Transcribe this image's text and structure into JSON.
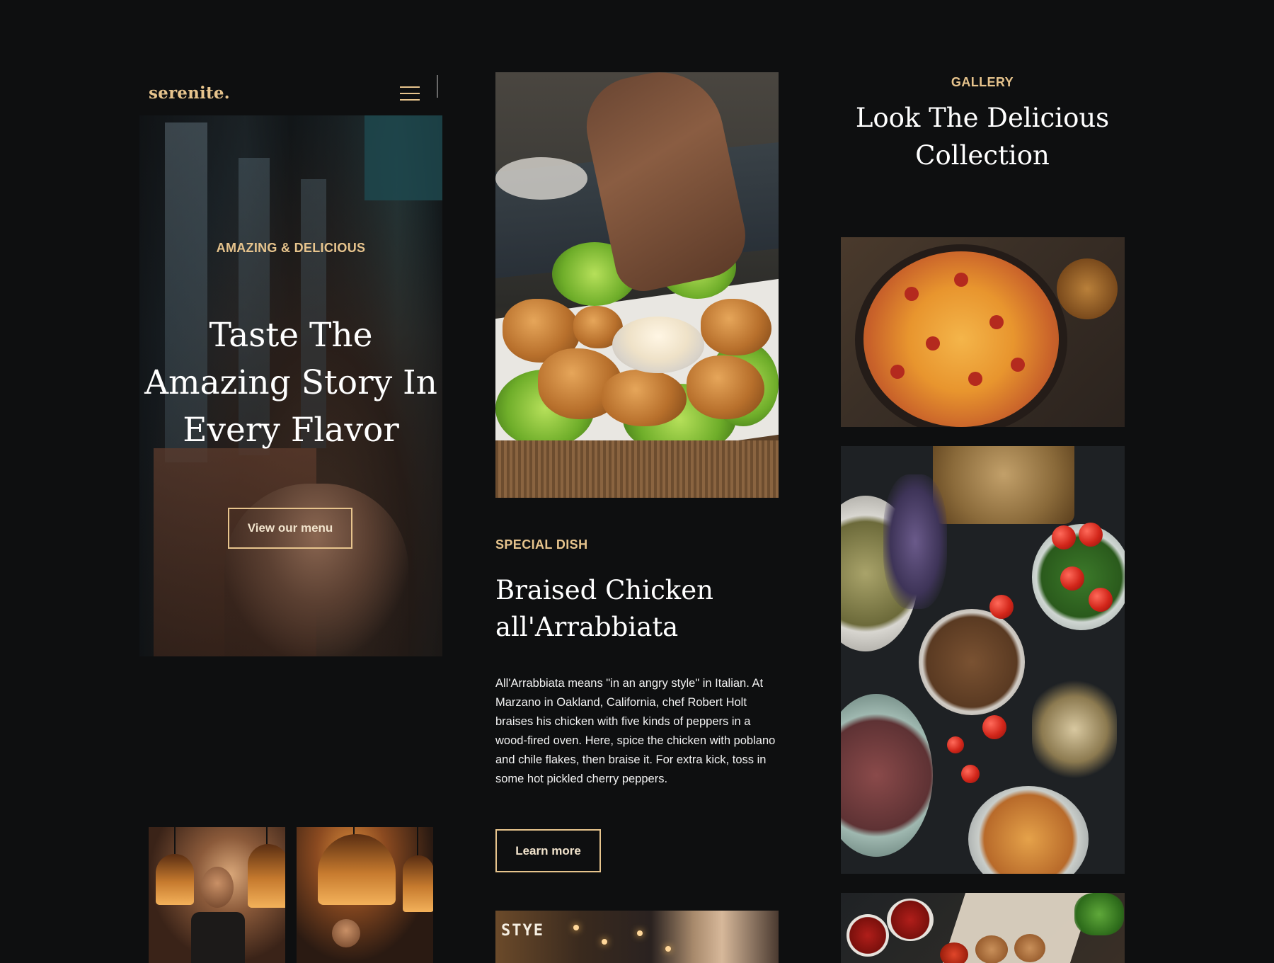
{
  "brand": {
    "logo_text": "serenite.",
    "accent_color": "#e7c48d",
    "background_color": "#0e0f10"
  },
  "nav": {
    "menu_icon": "hamburger-menu-icon"
  },
  "hero": {
    "eyebrow": "AMAZING & DELICIOUS",
    "title_lines": [
      "Taste The",
      "Amazing Story In",
      "Every Flavor"
    ],
    "cta_label": "View our menu"
  },
  "special_dish": {
    "eyebrow": "SPECIAL DISH",
    "title_lines": [
      "Braised Chicken",
      "all'Arrabbiata"
    ],
    "description": "All'Arrabbiata means \"in an angry style\" in Italian. At Marzano in Oakland, California, chef Robert Holt braises his chicken with five kinds of peppers in a wood-fired oven. Here, spice the chicken with poblano and chile flakes, then braise it. For extra kick, toss in some hot pickled cherry peppers.",
    "cta_label": "Learn more"
  },
  "gallery": {
    "eyebrow": "GALLERY",
    "title_lines": [
      "Look The Delicious",
      "Collection"
    ]
  },
  "images": {
    "hero_image": "restaurant-interior-image",
    "chef_image_1": "chef-cooking-image",
    "chef_image_2": "kitchen-lamps-image",
    "dish_image": "fried-chicken-dip-image",
    "restaurant_image": "restaurant-guest-image",
    "pizza_image": "pizza-image",
    "vegetables_image": "vegetables-flatlay-image",
    "bottom_image": "sauces-flatlay-image"
  }
}
